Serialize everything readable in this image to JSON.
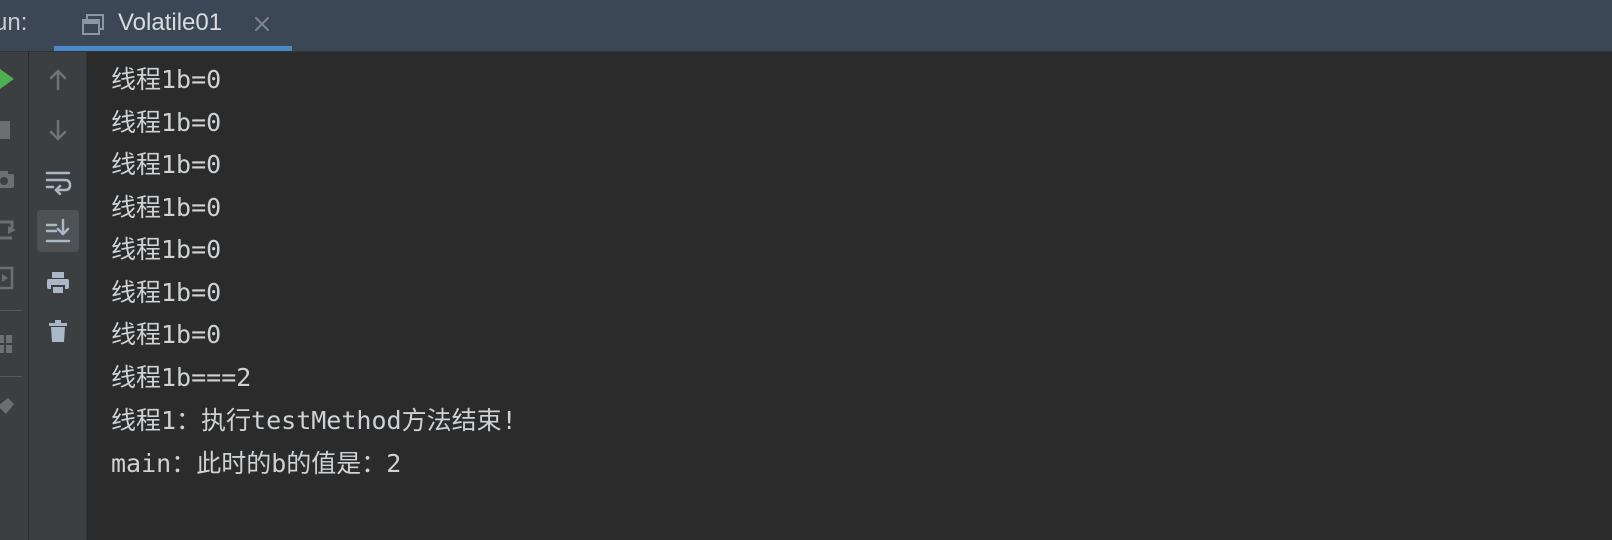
{
  "tool_window": {
    "run_label": "un:",
    "tab": {
      "title": "Volatile01"
    }
  },
  "toolbar_icons": [
    "up-arrow-icon",
    "down-arrow-icon",
    "soft-wrap-icon",
    "scroll-to-end-icon",
    "print-icon",
    "trash-icon"
  ],
  "left_strip_icons": [
    "run-icon",
    "stop-icon",
    "camera-icon",
    "restore-layout-icon",
    "exit-icon",
    "layout-icon",
    "pin-icon"
  ],
  "colors": {
    "tabbar_bg": "#3b4754",
    "toolbar_bg": "#3c3f41",
    "console_bg": "#2b2b2b",
    "tab_underline": "#4a88c7",
    "run_green": "#4caf50",
    "text": "#cfd2d4"
  },
  "console": {
    "lines": [
      "线程1b=0",
      "线程1b=0",
      "线程1b=0",
      "线程1b=0",
      "线程1b=0",
      "线程1b=0",
      "线程1b=0",
      "线程1b===2",
      "线程1：执行testMethod方法结束!",
      "main：此时的b的值是：2"
    ]
  }
}
